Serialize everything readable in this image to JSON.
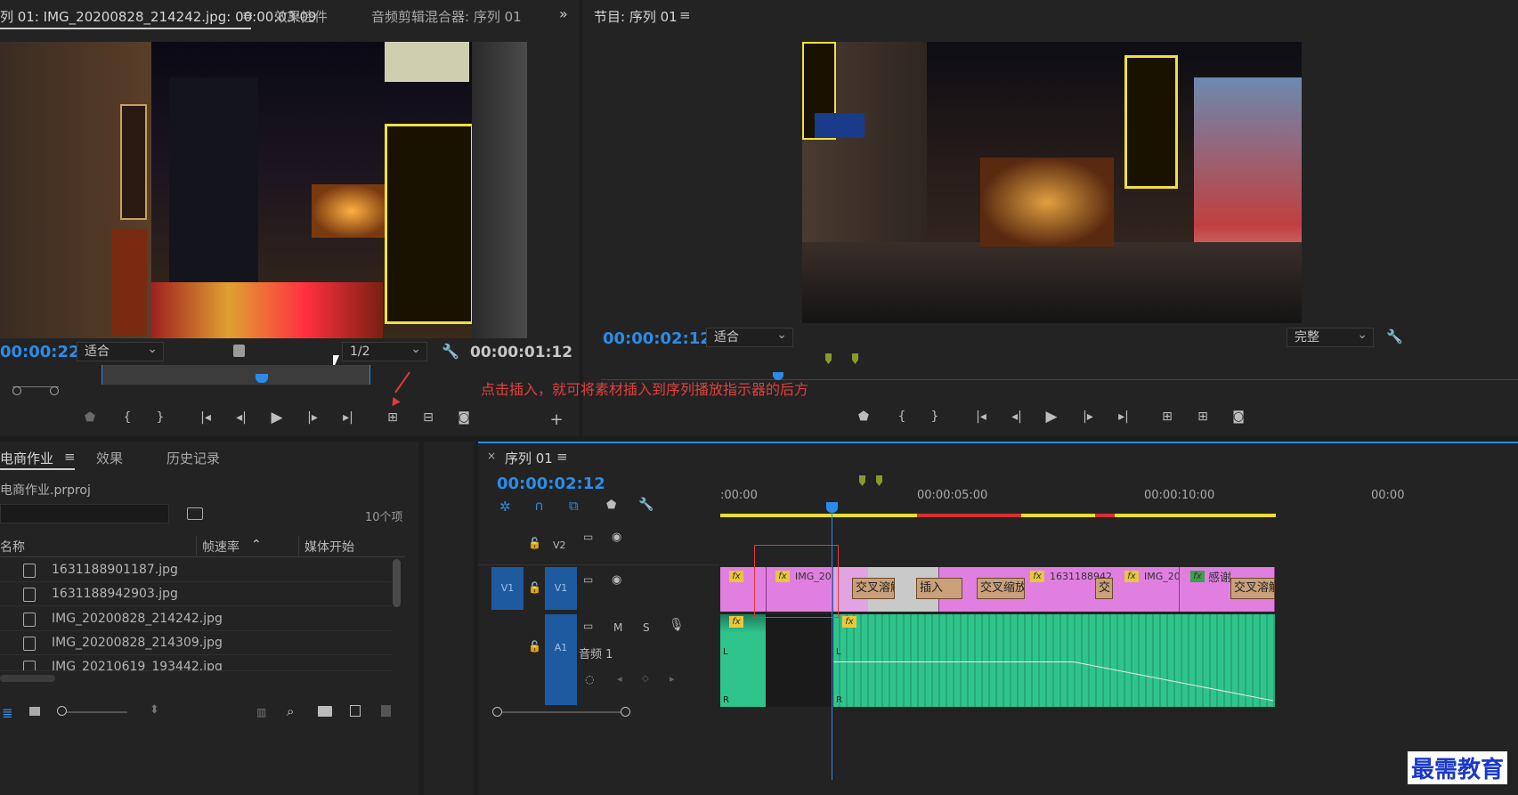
{
  "source_panel": {
    "tabs": [
      {
        "label": "列 01: IMG_20200828_214242.jpg: 00:00:03:09"
      },
      {
        "label": "效果控件"
      },
      {
        "label": "音频剪辑混合器: 序列 01"
      }
    ],
    "timecode_left": "00:00:22",
    "fit_label": "适合",
    "resolution": "1/2",
    "timecode_right": "00:00:01:12"
  },
  "program_panel": {
    "title": "节目: 序列 01",
    "timecode": "00:00:02:12",
    "fit_label": "适合",
    "quality": "完整"
  },
  "annotation": {
    "text": "点击插入，就可将素材插入到序列播放指示器的后方"
  },
  "project_panel": {
    "tabs": [
      {
        "label": "电商作业"
      },
      {
        "label": "效果"
      },
      {
        "label": "历史记录"
      }
    ],
    "project_file": "电商作业.prproj",
    "item_count": "10个项",
    "columns": [
      {
        "label": "名称"
      },
      {
        "label": "帧速率"
      },
      {
        "label": "媒体开始"
      }
    ],
    "files": [
      {
        "name": "1631188901187.jpg"
      },
      {
        "name": "1631188942903.jpg"
      },
      {
        "name": "IMG_20200828_214242.jpg"
      },
      {
        "name": "IMG_20200828_214309.jpg"
      },
      {
        "name": "IMG_20210619_193442.jpg"
      }
    ]
  },
  "timeline": {
    "title": "序列 01",
    "timecode": "00:00:02:12",
    "ruler": [
      {
        "label": ":00:00"
      },
      {
        "label": "00:00:05:00"
      },
      {
        "label": "00:00:10:00"
      },
      {
        "label": "00:00"
      }
    ],
    "tracks": {
      "v2": "V2",
      "v1_src": "V1",
      "v1": "V1",
      "a1": "A1",
      "m": "M",
      "s": "S",
      "audio_name": "音频 1"
    },
    "clips": {
      "img1": "IMG_202",
      "pic1": "1631188942",
      "img2": "IMG_202",
      "gan": "感谢",
      "fx": "fx"
    },
    "transitions": {
      "t1": "交叉溶解",
      "t2": "插入",
      "t3": "交叉缩放",
      "t4": "交",
      "t5": "交叉溶解"
    },
    "channels": {
      "l": "L",
      "r": "R"
    }
  },
  "watermark": "最需教育",
  "colors": {
    "accent": "#2b8ce8",
    "clip_pink": "#e07fe0",
    "audio_green": "#2fc48c",
    "track_blue": "#1d5aa0",
    "annotation_red": "#e03a3a"
  }
}
